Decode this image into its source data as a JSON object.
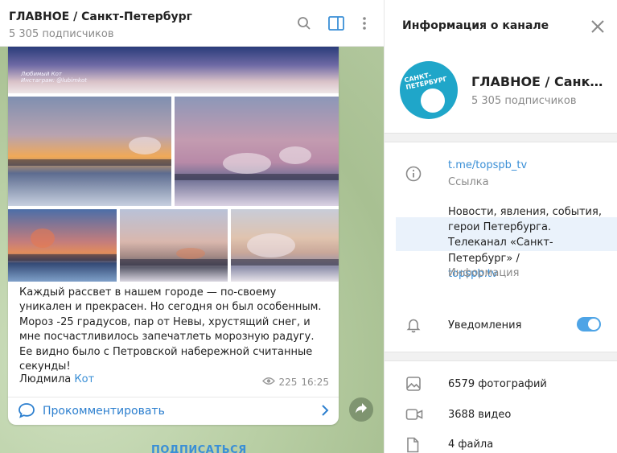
{
  "chat": {
    "title": "ГЛАВНОЕ / Санкт-Петербург",
    "subscribers": "5 305 подписчиков",
    "photo_caption_1": "Любимый Кот",
    "photo_caption_2": "Инстаграм: @lubimkot",
    "message_text": "Каждый рассвет в нашем городе — по-своему уникален и прекрасен. Но сегодня он был особенным. Мороз -25 градусов, пар от Невы, хрустящий снег, и мне посчастливилось запечатлеть морозную радугу. Ее видно было с Петровской набережной считанные секунды!",
    "signature_name": "Людмила",
    "signature_link": "Кот",
    "views": "225",
    "time": "16:25",
    "comment_label": "Прокомментировать",
    "subscribe_label": "ПОДПИСАТЬСЯ"
  },
  "panel": {
    "title": "Информация о канале",
    "channel_name": "ГЛАВНОЕ / Санкт-Петербург",
    "channel_subscribers": "5 305 подписчиков",
    "avatar_text": "САНКТ-ПЕТЕРБУРГ",
    "link": "t.me/topspb_tv",
    "link_label": "Ссылка",
    "description": "Новости, явления, события, герои Петербурга. Телеканал «Санкт-Петербург» /",
    "description_link": "topspb.tv",
    "description_label": "Информация",
    "notifications_label": "Уведомления",
    "notifications_on": true,
    "photos": "6579 фотографий",
    "videos": "3688 видео",
    "files": "4 файла"
  },
  "colors": {
    "accent": "#3a8fd6",
    "toggle": "#4ea4e6",
    "avatar": "#1fa6c9"
  }
}
